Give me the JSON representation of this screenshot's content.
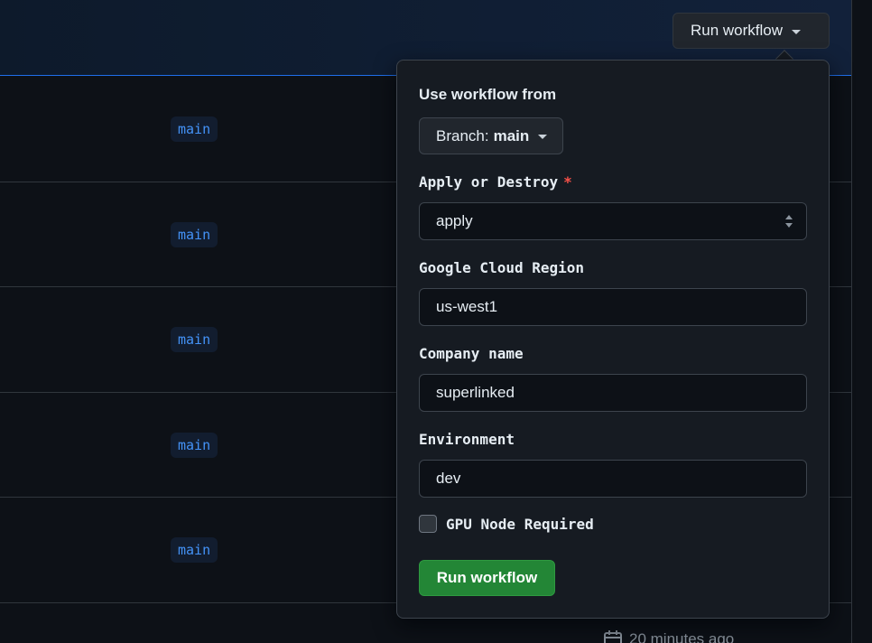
{
  "header": {
    "run_workflow_label": "Run workflow"
  },
  "runs": [
    {
      "branch": "main"
    },
    {
      "branch": "main"
    },
    {
      "branch": "main"
    },
    {
      "branch": "main"
    },
    {
      "branch": "main"
    }
  ],
  "footer_partial": {
    "time_text": "20 minutes ago"
  },
  "dialog": {
    "use_from_label": "Use workflow from",
    "branch_prefix": "Branch:",
    "branch_value": "main",
    "apply_destroy": {
      "label": "Apply or Destroy",
      "required_mark": "*",
      "value": "apply"
    },
    "region": {
      "label": "Google Cloud Region",
      "value": "us-west1"
    },
    "company": {
      "label": "Company name",
      "value": "superlinked"
    },
    "environment": {
      "label": "Environment",
      "value": "dev"
    },
    "gpu": {
      "label": "GPU Node Required",
      "checked": false
    },
    "submit_label": "Run workflow"
  },
  "colors": {
    "primary_button": "#238636",
    "link_blue": "#4493f8",
    "required": "#f85149",
    "background": "#0d1117"
  }
}
